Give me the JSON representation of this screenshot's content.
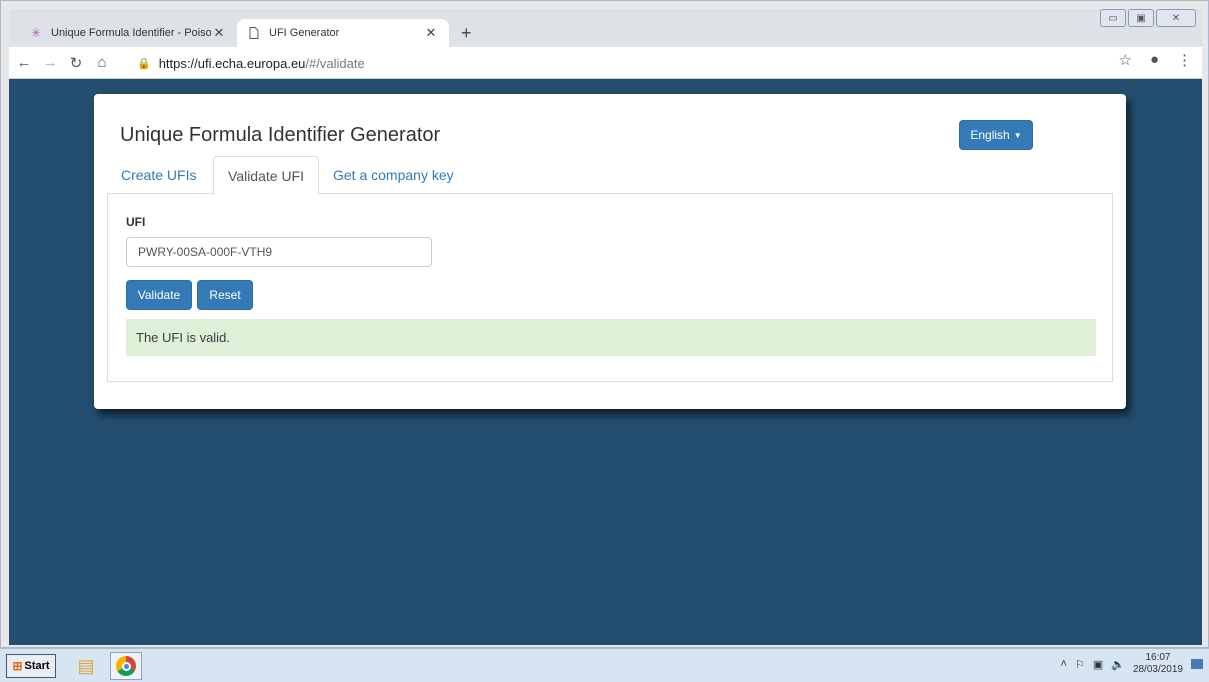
{
  "browser": {
    "tabs": [
      {
        "title": "Unique Formula Identifier - Poison C",
        "icon": "echa-star-icon"
      },
      {
        "title": "UFI Generator",
        "icon": "document-icon"
      }
    ],
    "url_host": "https://ufi.echa.europa.eu",
    "url_path": "/#/validate"
  },
  "app": {
    "title": "Unique Formula Identifier Generator",
    "language": "English",
    "nav_tabs": [
      "Create UFIs",
      "Validate UFI",
      "Get a company key"
    ],
    "active_tab": "Validate UFI",
    "form": {
      "label": "UFI",
      "value": "PWRY-00SA-000F-VTH9",
      "validate_label": "Validate",
      "reset_label": "Reset"
    },
    "result": "The UFI is valid."
  },
  "colors": {
    "page_bg": "#234e6f",
    "primary": "#337ab7",
    "success_bg": "#dff0d8"
  },
  "taskbar": {
    "start_label": "Start",
    "time": "16:07",
    "date": "28/03/2019"
  }
}
